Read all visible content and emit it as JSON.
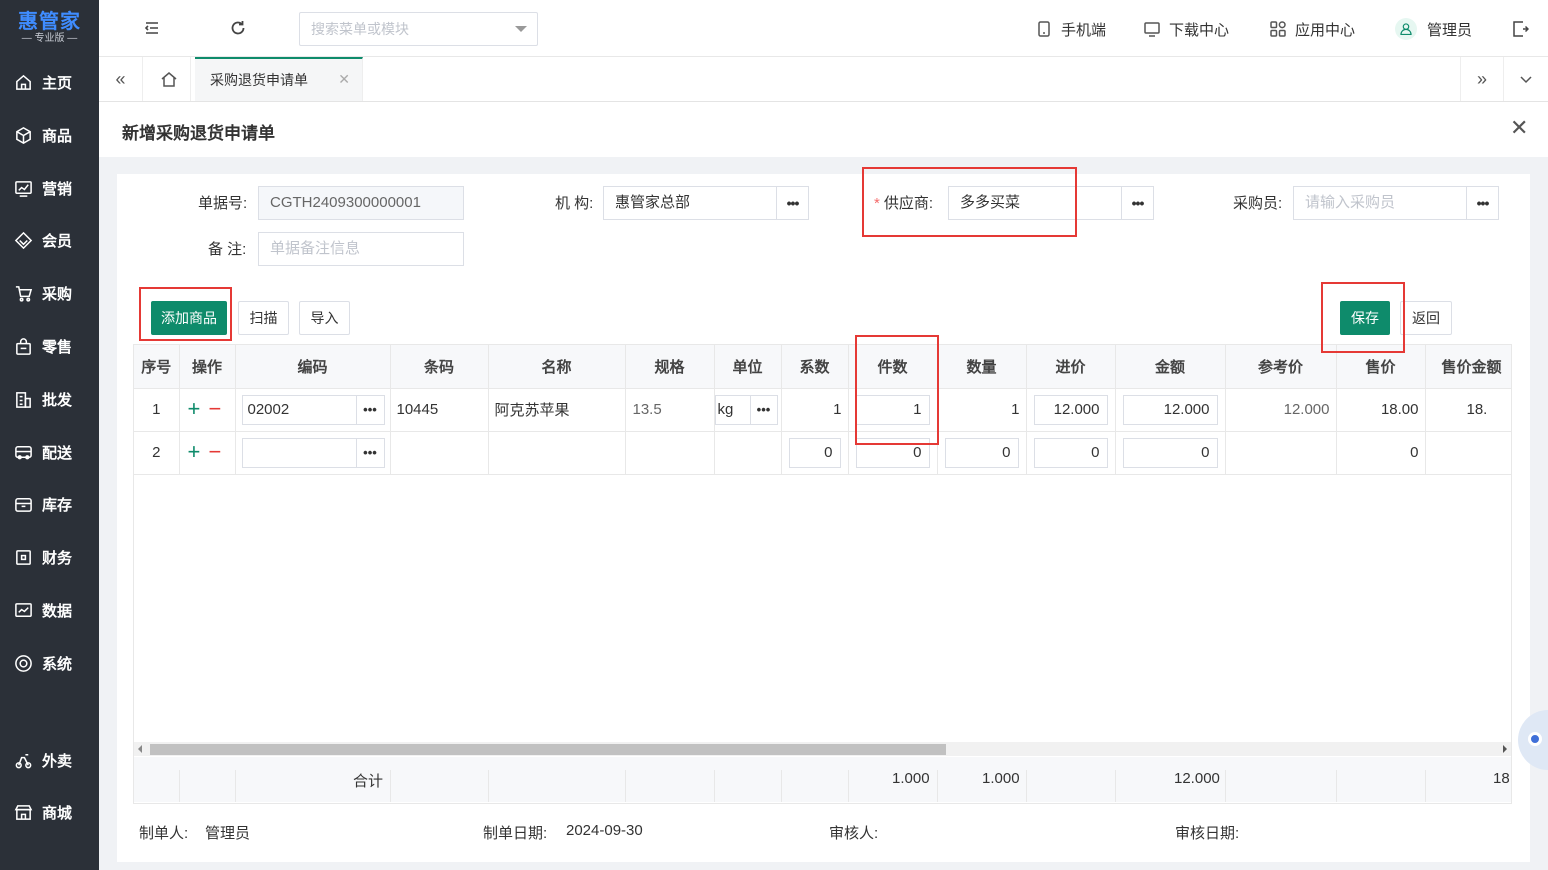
{
  "sidebar": {
    "brand": "惠管家",
    "edition": "— 专业版 —",
    "items": [
      {
        "label": "主页",
        "icon": "home-icon"
      },
      {
        "label": "商品",
        "icon": "cube-icon"
      },
      {
        "label": "营销",
        "icon": "chart-icon"
      },
      {
        "label": "会员",
        "icon": "diamond-icon"
      },
      {
        "label": "采购",
        "icon": "cart-icon"
      },
      {
        "label": "零售",
        "icon": "bag-icon"
      },
      {
        "label": "批发",
        "icon": "building-icon"
      },
      {
        "label": "配送",
        "icon": "truck-icon"
      },
      {
        "label": "库存",
        "icon": "box-icon"
      },
      {
        "label": "财务",
        "icon": "finance-icon"
      },
      {
        "label": "数据",
        "icon": "data-icon"
      },
      {
        "label": "系统",
        "icon": "settings-icon"
      },
      {
        "label": "外卖",
        "icon": "scooter-icon"
      },
      {
        "label": "商城",
        "icon": "store-icon"
      }
    ]
  },
  "topbar": {
    "search_placeholder": "搜索菜单或模块",
    "mobile": "手机端",
    "download": "下载中心",
    "apps": "应用中心",
    "user": "管理员"
  },
  "tabs": {
    "active": "采购退货申请单"
  },
  "page": {
    "title": "新增采购退货申请单"
  },
  "form": {
    "doc_no_label": "单据号:",
    "doc_no_value": "CGTH2409300000001",
    "org_label": "机 构:",
    "org_value": "惠管家总部",
    "supplier_label": "供应商:",
    "supplier_required": "*",
    "supplier_value": "多多买菜",
    "buyer_label": "采购员:",
    "buyer_placeholder": "请输入采购员",
    "remark_label": "备 注:",
    "remark_placeholder": "单据备注信息",
    "dots": "•••"
  },
  "toolbar": {
    "add": "添加商品",
    "scan": "扫描",
    "import": "导入",
    "save": "保存",
    "back": "返回"
  },
  "grid": {
    "columns": [
      "序号",
      "操作",
      "编码",
      "条码",
      "名称",
      "规格",
      "单位",
      "系数",
      "件数",
      "数量",
      "进价",
      "金额",
      "参考价",
      "售价",
      "售价金额"
    ],
    "rows": [
      {
        "seq": "1",
        "code": "02002",
        "barcode": "10445",
        "name": "阿克苏苹果",
        "spec": "13.5",
        "unit": "kg",
        "coef": "1",
        "pieces": "1",
        "qty": "1",
        "price": "12.000",
        "amount": "12.000",
        "ref_price": "12.000",
        "sale_price": "18.00",
        "sale_amount": "18."
      },
      {
        "seq": "2",
        "code": "",
        "barcode": "",
        "name": "",
        "spec": "",
        "unit": "",
        "coef": "0",
        "pieces": "0",
        "qty": "0",
        "price": "0",
        "amount": "0",
        "ref_price": "",
        "sale_price": "0",
        "sale_amount": ""
      }
    ],
    "total": {
      "label": "合计",
      "pieces": "1.000",
      "qty": "1.000",
      "amount": "12.000",
      "sale_amount": "18."
    }
  },
  "footer": {
    "creator_label": "制单人:",
    "creator_value": "管理员",
    "date_label": "制单日期:",
    "date_value": "2024-09-30",
    "reviewer_label": "审核人:",
    "review_date_label": "审核日期:"
  },
  "colors": {
    "sidebar_bg": "#2b3038",
    "primary": "#0e8b6b",
    "highlight": "#e53935"
  }
}
